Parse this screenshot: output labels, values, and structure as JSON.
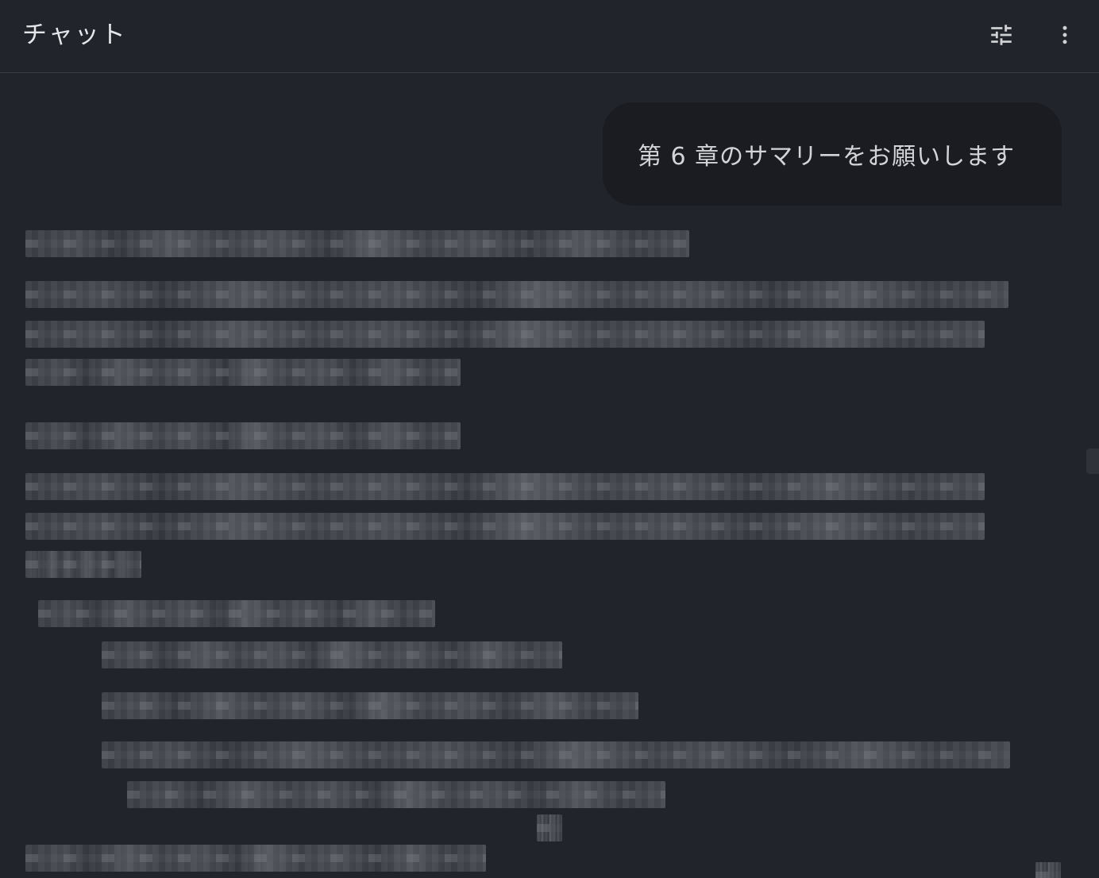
{
  "header": {
    "title": "チャット",
    "tune_icon": "tune-icon",
    "more_icon": "more-vert-icon"
  },
  "conversation": {
    "user_message": "第 6 章のサマリーをお願いします"
  },
  "colors": {
    "background": "#21242b",
    "bubble": "#1a1c21",
    "divider": "#3a3d44",
    "text": "#d6d8dc"
  }
}
